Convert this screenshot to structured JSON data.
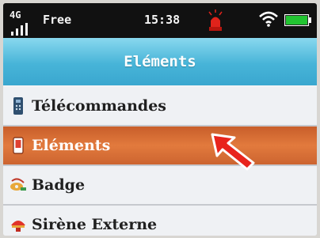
{
  "status": {
    "network": "4G",
    "carrier": "Free",
    "time": "15:38",
    "icons": [
      "signal-icon",
      "alarm-siren-icon",
      "wifi-icon",
      "battery-icon"
    ],
    "battery_color": "#22c431",
    "alarm_color": "#e0231b"
  },
  "header": {
    "title": "Eléments"
  },
  "menu": {
    "items": [
      {
        "label": "Télécommandes",
        "icon": "remote-control-icon",
        "selected": false
      },
      {
        "label": "Eléments",
        "icon": "sensor-device-icon",
        "selected": true
      },
      {
        "label": "Badge",
        "icon": "badge-key-icon",
        "selected": false
      },
      {
        "label": "Sirène Externe",
        "icon": "external-siren-icon",
        "selected": false
      }
    ]
  },
  "colors": {
    "title_bar": "#47b4d8",
    "selected_item": "#e27a3d",
    "menu_bg": "#eff1f4",
    "pointer": "#e8241d"
  }
}
